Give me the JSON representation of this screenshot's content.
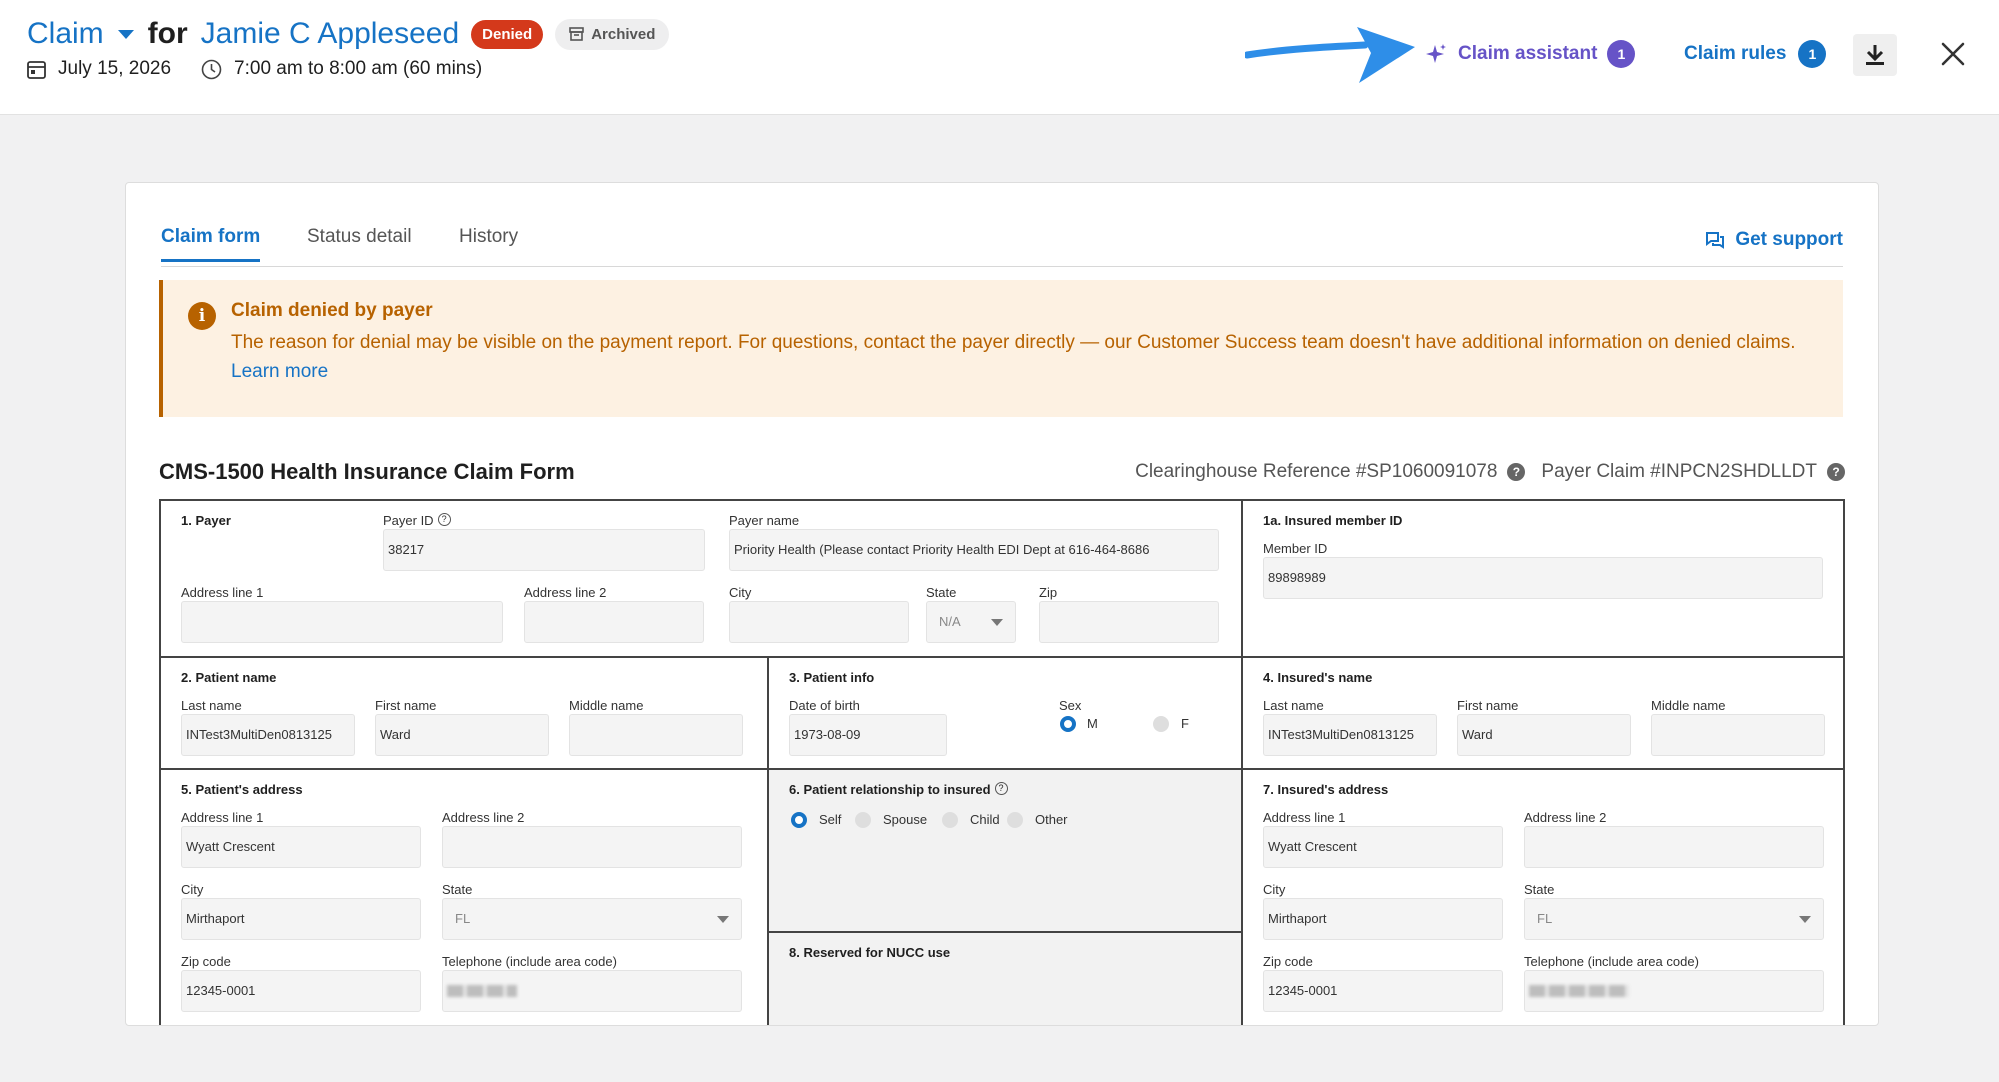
{
  "header": {
    "claim_label": "Claim",
    "for_label": "for",
    "patient_name": "Jamie C Appleseed",
    "status_badge": "Denied",
    "archived_badge": "Archived",
    "date": "July 15, 2026",
    "time": "7:00 am to 8:00 am (60 mins)",
    "assistant_label": "Claim assistant",
    "assistant_count": "1",
    "rules_label": "Claim rules",
    "rules_count": "1",
    "accent_color": "#1673c5",
    "assistant_color": "#6653c7",
    "denied_color": "#d4391b"
  },
  "tabs": [
    "Claim form",
    "Status detail",
    "History"
  ],
  "support_label": "Get support",
  "alert": {
    "title": "Claim denied by payer",
    "body": "The reason for denial may be visible on the payment report. For questions, contact the payer directly — our Customer Success team doesn't have additional information on denied claims.",
    "link": "Learn more",
    "color": "#b76200"
  },
  "form": {
    "title": "CMS-1500 Health Insurance Claim Form",
    "clearinghouse_ref": "Clearinghouse Reference #SP1060091078",
    "payer_claim": "Payer Claim #INPCN2SHDLLDT",
    "payer": {
      "section": "1. Payer",
      "payer_id_label": "Payer ID",
      "payer_id": "38217",
      "payer_name_label": "Payer name",
      "payer_name": "Priority Health (Please contact Priority Health EDI Dept at 616-464-8686",
      "address1_label": "Address line 1",
      "address1": "",
      "address2_label": "Address line 2",
      "address2": "",
      "city_label": "City",
      "city": "",
      "state_label": "State",
      "state": "N/A",
      "zip_label": "Zip",
      "zip": ""
    },
    "insured_member": {
      "section": "1a. Insured member ID",
      "member_id_label": "Member ID",
      "member_id": "89898989"
    },
    "patient_name": {
      "section": "2. Patient name",
      "last_label": "Last name",
      "last": "INTest3MultiDen0813125",
      "first_label": "First name",
      "first": "Ward",
      "middle_label": "Middle name",
      "middle": ""
    },
    "patient_info": {
      "section": "3. Patient info",
      "dob_label": "Date of birth",
      "dob": "1973-08-09",
      "sex_label": "Sex",
      "sex_m": "M",
      "sex_f": "F",
      "sex_selected": "M"
    },
    "insured_name": {
      "section": "4. Insured's name",
      "last_label": "Last name",
      "last": "INTest3MultiDen0813125",
      "first_label": "First name",
      "first": "Ward",
      "middle_label": "Middle name",
      "middle": ""
    },
    "patient_address": {
      "section": "5. Patient's address",
      "address1_label": "Address line 1",
      "address1": "Wyatt Crescent",
      "address2_label": "Address line 2",
      "address2": "",
      "city_label": "City",
      "city": "Mirthaport",
      "state_label": "State",
      "state": "FL",
      "zip_label": "Zip code",
      "zip": "12345-0001",
      "phone_label": "Telephone (include area code)"
    },
    "relationship": {
      "section": "6. Patient relationship to insured",
      "options": [
        "Self",
        "Spouse",
        "Child",
        "Other"
      ],
      "selected": "Self"
    },
    "nucc": {
      "section": "8. Reserved for NUCC use"
    },
    "insured_address": {
      "section": "7. Insured's address",
      "address1_label": "Address line 1",
      "address1": "Wyatt Crescent",
      "address2_label": "Address line 2",
      "address2": "",
      "city_label": "City",
      "city": "Mirthaport",
      "state_label": "State",
      "state": "FL",
      "zip_label": "Zip code",
      "zip": "12345-0001",
      "phone_label": "Telephone (include area code)"
    }
  }
}
